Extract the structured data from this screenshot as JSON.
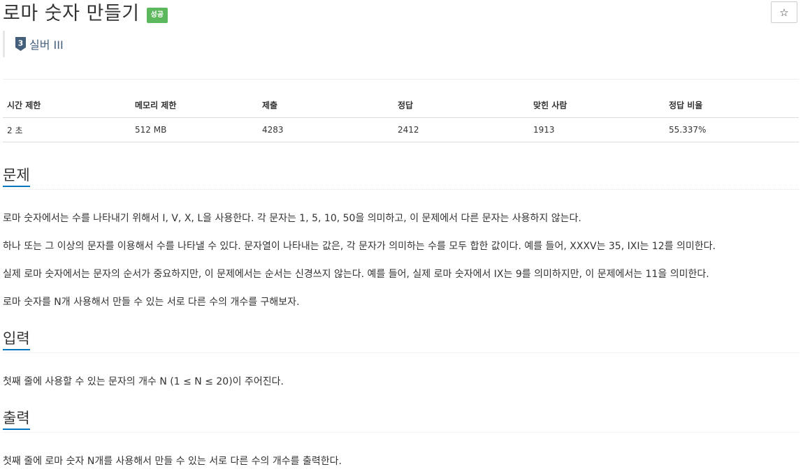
{
  "header": {
    "title": "로마 숫자 만들기",
    "status_badge": "성공",
    "star_label": "☆",
    "tier_number": "3",
    "tier_label": "실버 III"
  },
  "info_table": {
    "headers": [
      "시간 제한",
      "메모리 제한",
      "제출",
      "정답",
      "맞힌 사람",
      "정답 비율"
    ],
    "values": [
      "2 초",
      "512 MB",
      "4283",
      "2412",
      "1913",
      "55.337%"
    ]
  },
  "problem": {
    "heading": "문제",
    "paragraphs": [
      "로마 숫자에서는 수를 나타내기 위해서 I, V, X, L을 사용한다. 각 문자는 1, 5, 10, 50을 의미하고, 이 문제에서 다른 문자는 사용하지 않는다.",
      "하나 또는 그 이상의 문자를 이용해서 수를 나타낼 수 있다. 문자열이 나타내는 값은, 각 문자가 의미하는 수를 모두 합한 값이다. 예를 들어, XXXV는 35, IXI는 12를 의미한다.",
      "실제 로마 숫자에서는 문자의 순서가 중요하지만, 이 문제에서는 순서는 신경쓰지 않는다. 예를 들어, 실제 로마 숫자에서 IX는 9를 의미하지만, 이 문제에서는 11을 의미한다.",
      "로마 숫자를 N개 사용해서 만들 수 있는 서로 다른 수의 개수를 구해보자."
    ]
  },
  "input": {
    "heading": "입력",
    "text": "첫째 줄에 사용할 수 있는 문자의 개수 N (1 ≤ N ≤ 20)이 주어진다."
  },
  "output": {
    "heading": "출력",
    "text": "첫째 줄에 로마 숫자 N개를 사용해서 만들 수 있는 서로 다른 수의 개수를 출력한다."
  },
  "colors": {
    "badge_success": "#5cb85c",
    "heading_underline": "#0076c0",
    "tier_silver": "#435f7a"
  }
}
